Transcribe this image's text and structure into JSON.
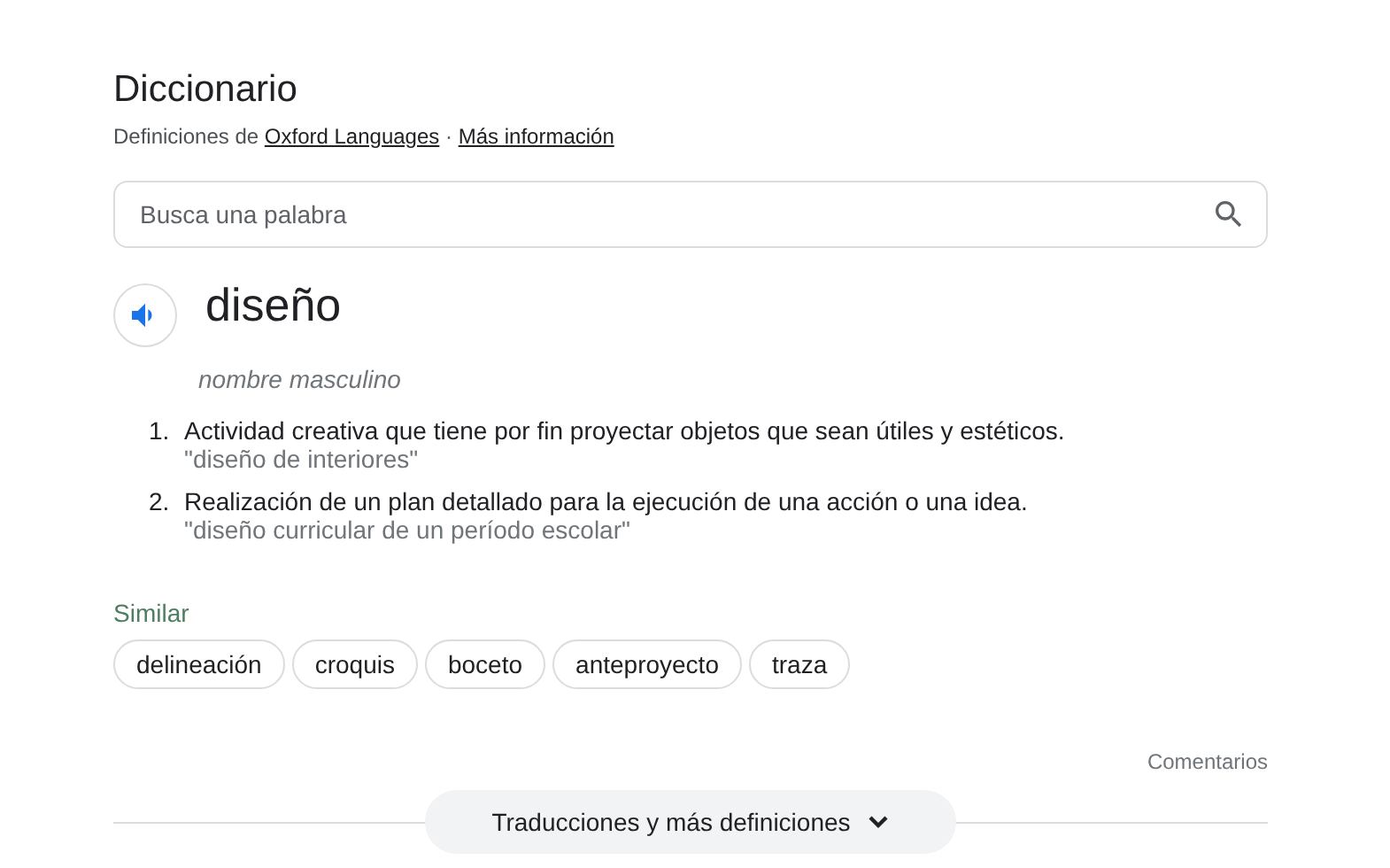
{
  "title": "Diccionario",
  "source": {
    "prefix": "Definiciones de",
    "source_link": "Oxford Languages",
    "separator": "·",
    "more_link": "Más información"
  },
  "search": {
    "placeholder": "Busca una palabra"
  },
  "entry": {
    "word": "diseño",
    "part_of_speech": "nombre masculino",
    "definitions": [
      {
        "number": "1.",
        "text": "Actividad creativa que tiene por fin proyectar objetos que sean útiles y estéticos.",
        "example": "\"diseño de interiores\""
      },
      {
        "number": "2.",
        "text": "Realización de un plan detallado para la ejecución de una acción o una idea.",
        "example": "\"diseño curricular de un período escolar\""
      }
    ]
  },
  "similar": {
    "label": "Similar",
    "words": [
      "delineación",
      "croquis",
      "boceto",
      "anteproyecto",
      "traza"
    ]
  },
  "feedback": "Comentarios",
  "more_button": "Traducciones y más definiciones"
}
